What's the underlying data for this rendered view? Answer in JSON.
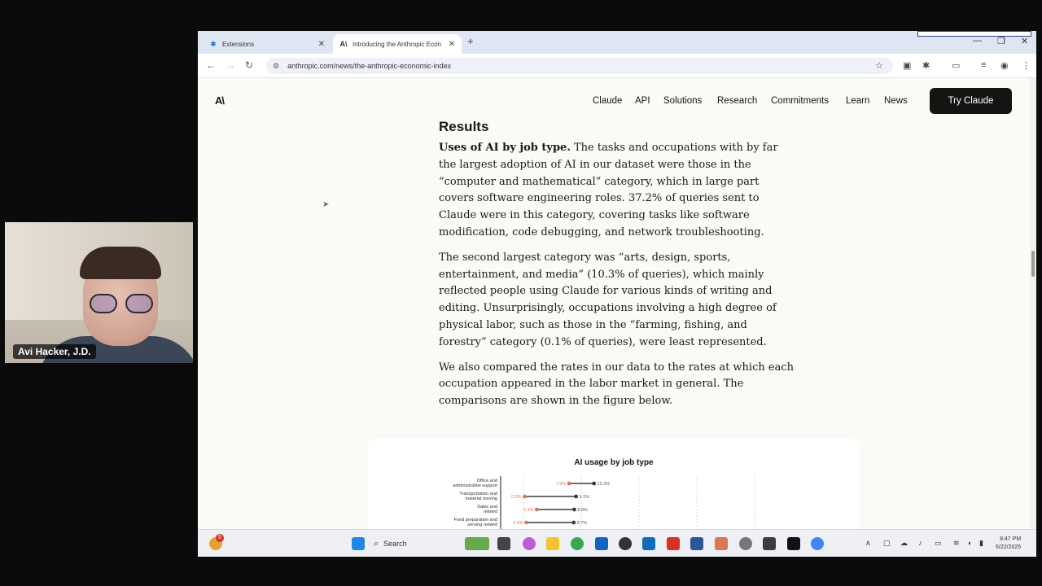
{
  "webcam": {
    "name": "Avi Hacker, J.D."
  },
  "browser": {
    "tabs": [
      {
        "label": "Extensions",
        "icon": "puzzle-icon",
        "active": false
      },
      {
        "label": "Introducing the Anthropic Econ",
        "icon": "anthropic-icon",
        "active": true
      }
    ],
    "url": "anthropic.com/news/the-anthropic-economic-index"
  },
  "site": {
    "logo": "A\\",
    "nav": [
      "Claude",
      "API",
      "Solutions",
      "Research",
      "Commitments",
      "Learn",
      "News"
    ],
    "cta": "Try Claude"
  },
  "article": {
    "heading": "Results",
    "p1_lead": "Uses of AI by job type.",
    "p1_body": " The tasks and occupations with by far the largest adoption of AI in our dataset were those in the “computer and mathematical” category, which in large part covers software engineering roles. 37.2% of queries sent to Claude were in this category, covering tasks like software modification, code debugging, and network troubleshooting.",
    "p2": "The second largest category was “arts, design, sports, entertainment, and media” (10.3% of queries), which mainly reflected people using Claude for various kinds of writing and editing. Unsurprisingly, occupations involving a high degree of physical labor, such as those in the “farming, fishing, and forestry” category (0.1% of queries), were least represented.",
    "p3": "We also compared the rates in our data to the rates at which each occupation appeared in the labor market in general. The comparisons are shown in the figure below."
  },
  "chart_data": {
    "type": "scatter",
    "title": "AI usage by job type",
    "categories": [
      "Office and administrative support",
      "Transportation and material moving",
      "Sales and related",
      "Food preparation and serving related"
    ],
    "series": [
      {
        "values": [
          7.9,
          0.2,
          2.3,
          0.5
        ],
        "labels": [
          "7.9%",
          "0.2%",
          "2.3%",
          "0.5%"
        ],
        "color": "#d97757"
      },
      {
        "values": [
          12.2,
          9.1,
          8.8,
          8.7
        ],
        "labels": [
          "12.2%",
          "9.1%",
          "8.8%",
          "8.7%"
        ],
        "color": "#3d3d3a"
      }
    ],
    "xlim": [
      0,
      40
    ],
    "grid": true
  },
  "taskbar": {
    "search_label": "Search",
    "notification_count": "5",
    "time": "8:47 PM",
    "date": "6/22/2025"
  }
}
